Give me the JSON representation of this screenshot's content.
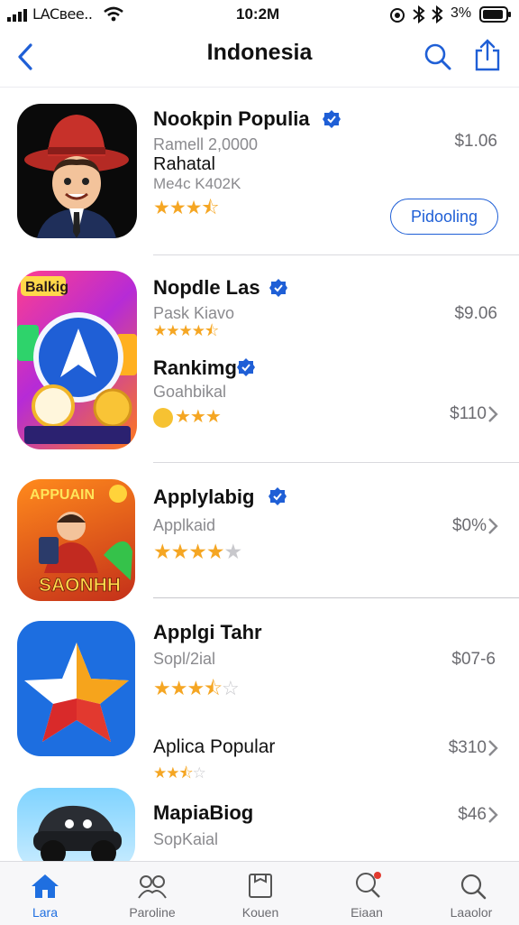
{
  "status_bar": {
    "carrier": "LACвee..",
    "time": "10:2M",
    "battery": "3%"
  },
  "nav": {
    "title": "Indonesia"
  },
  "apps": [
    {
      "name": "Nookpin Populia",
      "line1": "Ramell 2,0000",
      "line2": "Rahatal",
      "line3": "Me4c K402K",
      "price": "$1.06",
      "action": "Pidooling",
      "rating": 3.5
    },
    {
      "name": "Nopdle Las",
      "line1": "Pask Kiavo",
      "price": "$9.06",
      "rating": 4.5
    },
    {
      "name": "Rankimg",
      "line1": "Goahbikal",
      "price": "$110",
      "rating": 3.5
    },
    {
      "name": "Applylabig",
      "line1": "Applkaid",
      "price": "$0%",
      "rating": 4
    },
    {
      "name": "Applgi Tahr",
      "line1": "Sopl/2ial",
      "price": "$07-6",
      "rating": 3.5
    },
    {
      "name": "Aplica Popular",
      "price": "$310",
      "rating": 2.5
    },
    {
      "name": "MapiaBiog",
      "line1": "SopKaial",
      "price": "$46"
    }
  ],
  "icons": {
    "icon1_text": "",
    "icon2_top": "Balkig",
    "icon3_top": "APPUAIN",
    "icon3_bottom": "SAONHH"
  },
  "tabs": [
    {
      "label": "Lara",
      "icon": "home-icon"
    },
    {
      "label": "Paroline",
      "icon": "people-icon"
    },
    {
      "label": "Kouen",
      "icon": "box-icon"
    },
    {
      "label": "Eiaan",
      "icon": "search-person-icon"
    },
    {
      "label": "Laaolor",
      "icon": "search-icon"
    }
  ],
  "colors": {
    "accent": "#1f5fd6",
    "star": "#f5a623",
    "tab_active": "#1f6fe0"
  }
}
